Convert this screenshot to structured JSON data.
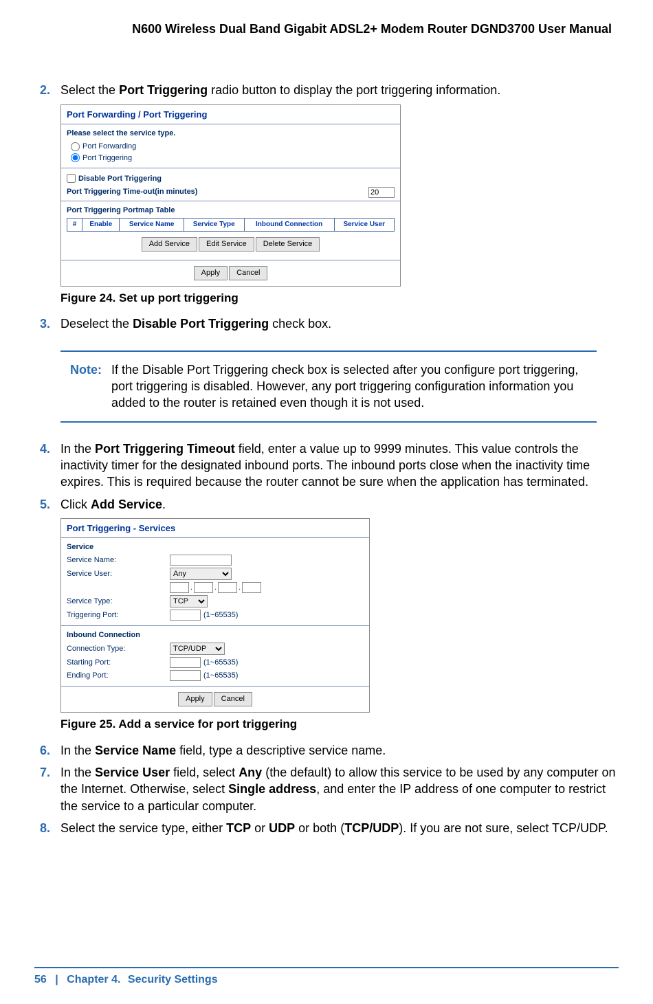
{
  "header": {
    "manual_title": "N600 Wireless Dual Band Gigabit ADSL2+ Modem Router DGND3700 User Manual"
  },
  "steps": {
    "s2": {
      "num": "2.",
      "pre": "Select the ",
      "bold": "Port Triggering",
      "post": " radio button to display the port triggering information."
    },
    "s3": {
      "num": "3.",
      "pre": "Deselect the ",
      "bold": "Disable Port Triggering",
      "post": " check box."
    },
    "s4": {
      "num": "4.",
      "pre": "In the ",
      "bold": "Port Triggering Timeout",
      "post": " field, enter a value up to 9999 minutes. This value controls the inactivity timer for the designated inbound ports. The inbound ports close when the inactivity time expires. This is required because the router cannot be sure when the application has terminated."
    },
    "s5": {
      "num": "5.",
      "pre": "Click ",
      "bold": "Add Service",
      "post": "."
    },
    "s6": {
      "num": "6.",
      "pre": "In the ",
      "bold": "Service Name",
      "post": " field, type a descriptive service name."
    },
    "s7": {
      "num": "7.",
      "p1_pre": "In the ",
      "p1_b1": "Service User",
      "p1_mid1": " field, select ",
      "p1_b2": "Any",
      "p1_mid2": " (the default) to allow this service to be used by any computer on the Internet. Otherwise, select ",
      "p1_b3": "Single address",
      "p1_post": ", and enter the IP address of one computer to restrict the service to a particular computer."
    },
    "s8": {
      "num": "8.",
      "pre": "Select the service type, either ",
      "b1": "TCP",
      "mid1": " or ",
      "b2": "UDP",
      "mid2": " or both (",
      "b3": "TCP/UDP",
      "post": "). If you are not sure, select TCP/UDP."
    }
  },
  "note": {
    "label": "Note:",
    "text": "If the Disable Port Triggering check box is selected after you configure port triggering, port triggering is disabled. However, any port triggering configuration information you added to the router is retained even though it is not used."
  },
  "fig24": {
    "caption": "Figure 24.  Set up port triggering",
    "title": "Port Forwarding / Port Triggering",
    "select_label": "Please select the service type.",
    "opt_forwarding": "Port Forwarding",
    "opt_triggering": "Port Triggering",
    "disable_label": "Disable Port Triggering",
    "timeout_label": "Port Triggering Time-out(in minutes)",
    "timeout_value": "20",
    "portmap_label": "Port Triggering Portmap Table",
    "th_num": "#",
    "th_enable": "Enable",
    "th_service_name": "Service Name",
    "th_service_type": "Service Type",
    "th_inbound": "Inbound Connection",
    "th_service_user": "Service User",
    "btn_add": "Add Service",
    "btn_edit": "Edit Service",
    "btn_delete": "Delete Service",
    "btn_apply": "Apply",
    "btn_cancel": "Cancel"
  },
  "fig25": {
    "caption": "Figure 25.  Add a service for port triggering",
    "title": "Port Triggering - Services",
    "sec_service": "Service",
    "lbl_service_name": "Service Name:",
    "lbl_service_user": "Service User:",
    "val_service_user": "Any",
    "lbl_service_type": "Service Type:",
    "val_service_type": "TCP",
    "lbl_trigger_port": "Triggering Port:",
    "hint_range": "(1~65535)",
    "sec_inbound": "Inbound Connection",
    "lbl_conn_type": "Connection Type:",
    "val_conn_type": "TCP/UDP",
    "lbl_start_port": "Starting Port:",
    "lbl_end_port": "Ending Port:",
    "btn_apply": "Apply",
    "btn_cancel": "Cancel"
  },
  "footer": {
    "page": "56",
    "sep": "|",
    "chapter_pre": "Chapter 4.",
    "chapter_title": "Security Settings"
  }
}
